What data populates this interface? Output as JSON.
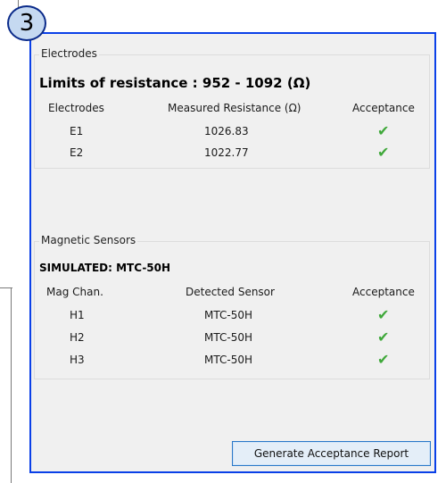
{
  "annotation": {
    "number": "3"
  },
  "electrodes": {
    "group_title": "Electrodes",
    "limits_title": "Limits of resistance : 952 - 1092 (Ω)",
    "headers": [
      "Electrodes",
      "Measured Resistance (Ω)",
      "Acceptance"
    ],
    "rows": [
      {
        "name": "E1",
        "value": "1026.83",
        "accepted": "✔"
      },
      {
        "name": "E2",
        "value": "1022.77",
        "accepted": "✔"
      }
    ]
  },
  "magnetic": {
    "group_title": "Magnetic Sensors",
    "simulated_title": "SIMULATED: MTC-50H",
    "headers": [
      "Mag Chan.",
      "Detected Sensor",
      "Acceptance"
    ],
    "rows": [
      {
        "name": "H1",
        "sensor": "MTC-50H",
        "accepted": "✔"
      },
      {
        "name": "H2",
        "sensor": "MTC-50H",
        "accepted": "✔"
      },
      {
        "name": "H3",
        "sensor": "MTC-50H",
        "accepted": "✔"
      }
    ]
  },
  "footer": {
    "report_button": "Generate Acceptance Report"
  },
  "colors": {
    "accept": "#3fa83a",
    "highlight_border": "#0a40e8"
  }
}
